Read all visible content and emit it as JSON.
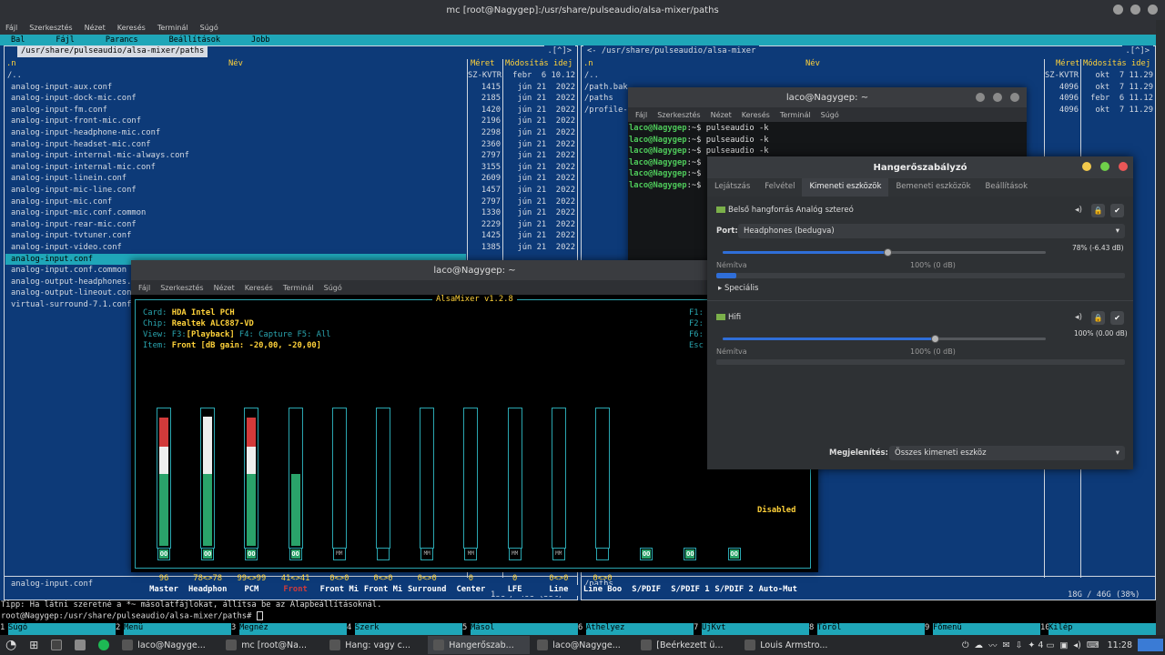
{
  "mc_title": "mc [root@Nagygep]:/usr/share/pulseaudio/alsa-mixer/paths",
  "mc_menubar": [
    "Fájl",
    "Szerkesztés",
    "Nézet",
    "Keresés",
    "Terminál",
    "Súgó"
  ],
  "mc_topbar": [
    "Bal",
    "Fájl",
    "Parancs",
    "Beállítások",
    "Jobb"
  ],
  "left_panel": {
    "path": " /usr/share/pulseaudio/alsa-mixer/paths ",
    "scroll": ".[^]>",
    "col_n": ".n",
    "col_name": "Név",
    "col_size": "Méret",
    "col_mtime": "Módosítás idej",
    "rows": [
      {
        "name": "/..",
        "size": "SZ-KVTR",
        "mtime": "febr  6 10.12"
      },
      {
        "name": "analog-input-aux.conf",
        "size": "1415",
        "mtime": "jún 21  2022"
      },
      {
        "name": "analog-input-dock-mic.conf",
        "size": "2185",
        "mtime": "jún 21  2022"
      },
      {
        "name": "analog-input-fm.conf",
        "size": "1420",
        "mtime": "jún 21  2022"
      },
      {
        "name": "analog-input-front-mic.conf",
        "size": "2196",
        "mtime": "jún 21  2022"
      },
      {
        "name": "analog-input-headphone-mic.conf",
        "size": "2298",
        "mtime": "jún 21  2022"
      },
      {
        "name": "analog-input-headset-mic.conf",
        "size": "2360",
        "mtime": "jún 21  2022"
      },
      {
        "name": "analog-input-internal-mic-always.conf",
        "size": "2797",
        "mtime": "jún 21  2022"
      },
      {
        "name": "analog-input-internal-mic.conf",
        "size": "3155",
        "mtime": "jún 21  2022"
      },
      {
        "name": "analog-input-linein.conf",
        "size": "2609",
        "mtime": "jún 21  2022"
      },
      {
        "name": "analog-input-mic-line.conf",
        "size": "1457",
        "mtime": "jún 21  2022"
      },
      {
        "name": "analog-input-mic.conf",
        "size": "2797",
        "mtime": "jún 21  2022"
      },
      {
        "name": "analog-input-mic.conf.common",
        "size": "1330",
        "mtime": "jún 21  2022"
      },
      {
        "name": "analog-input-rear-mic.conf",
        "size": "2229",
        "mtime": "jún 21  2022"
      },
      {
        "name": "analog-input-tvtuner.conf",
        "size": "1425",
        "mtime": "jún 21  2022"
      },
      {
        "name": "analog-input-video.conf",
        "size": "1385",
        "mtime": "jún 21  2022"
      },
      {
        "name": "analog-input.conf",
        "size": "",
        "mtime": ""
      },
      {
        "name": "analog-input.conf.common",
        "size": "",
        "mtime": ""
      },
      {
        "name": "analog-output-headphones.",
        "size": "",
        "mtime": ""
      },
      {
        "name": "analog-output-lineout.con",
        "size": "",
        "mtime": ""
      },
      {
        "name": "virtual-surround-7.1.conf",
        "size": "",
        "mtime": ""
      }
    ],
    "selected_index": 16,
    "mini": "analog-input.conf",
    "free": "18G / 46G (38%)"
  },
  "right_panel": {
    "path": "<- /usr/share/pulseaudio/alsa-mixer",
    "scroll": ".[^]>",
    "col_n": ".n",
    "col_name": "Név",
    "col_size": "Méret",
    "col_mtime": "Módosítás idej",
    "rows": [
      {
        "name": "/..",
        "size": "SZ-KVTR",
        "mtime": "okt  7 11.29"
      },
      {
        "name": "/path.bak",
        "size": "4096",
        "mtime": "okt  7 11.29"
      },
      {
        "name": "/paths",
        "size": "4096",
        "mtime": "febr  6 11.12"
      },
      {
        "name": "/profile-",
        "size": "4096",
        "mtime": "okt  7 11.29"
      }
    ],
    "mini": "/paths",
    "free": "18G / 46G (38%)"
  },
  "tip": "Tipp: Ha látni szeretné a *~ másolatfájlokat, állítsa be az Alapbeállításoknál.",
  "prompt": "root@Nagygep:/usr/share/pulseaudio/alsa-mixer/paths# ",
  "fkeys": [
    {
      "n": "1",
      "l": "Súgó"
    },
    {
      "n": "2",
      "l": "Menü"
    },
    {
      "n": "3",
      "l": "Megnéz"
    },
    {
      "n": "4",
      "l": "Szerk"
    },
    {
      "n": "5",
      "l": "Másol"
    },
    {
      "n": "6",
      "l": "Áthelyez"
    },
    {
      "n": "7",
      "l": "ÚjKvt"
    },
    {
      "n": "8",
      "l": "Töröl"
    },
    {
      "n": "9",
      "l": "Főmenü"
    },
    {
      "n": "10",
      "l": "Kilép"
    }
  ],
  "pulse_term": {
    "title": "laco@Nagygep: ~",
    "menu": [
      "Fájl",
      "Szerkesztés",
      "Nézet",
      "Keresés",
      "Terminál",
      "Súgó"
    ],
    "lines": [
      {
        "user": "laco@Nagygep",
        "rest": ":~$ pulseaudio -k"
      },
      {
        "user": "laco@Nagygep",
        "rest": ":~$ pulseaudio -k"
      },
      {
        "user": "laco@Nagygep",
        "rest": ":~$ pulseaudio -k"
      },
      {
        "user": "laco@Nagygep",
        "rest": ":~$"
      },
      {
        "user": "laco@Nagygep",
        "rest": ":~$"
      },
      {
        "user": "laco@Nagygep",
        "rest": ":~$"
      }
    ]
  },
  "alsa_term": {
    "title": "laco@Nagygep: ~",
    "menu": [
      "Fájl",
      "Szerkesztés",
      "Nézet",
      "Keresés",
      "Terminál",
      "Súgó"
    ],
    "mixer_title": "AlsaMixer v1.2.8",
    "card_label": "Card:",
    "card": "HDA Intel PCH",
    "chip_label": "Chip:",
    "chip": "Realtek ALC887-VD",
    "view_label": "View:",
    "view_f3": "F3:",
    "view_playback": "[Playback]",
    "view_f4": " F4: Capture  F5: All",
    "item_label": "Item:",
    "item": "Front [dB gain: -20,00, -20,00]",
    "fkeys_right": [
      "F1:",
      "F2:",
      "F6:",
      "Esc"
    ],
    "disabled": "Disabled",
    "channels": [
      {
        "name": "Master",
        "level": "96",
        "mute": "OO",
        "green": 0.53,
        "white": 0.2,
        "red": 0.21
      },
      {
        "name": "Headphon",
        "level": "78<>78",
        "mute": "OO",
        "green": 0.53,
        "white": 0.42,
        "red": 0
      },
      {
        "name": "PCM",
        "level": "99<>99",
        "mute": "OO",
        "green": 0.53,
        "white": 0.2,
        "red": 0.21
      },
      {
        "name": "Front",
        "level": "41<>41",
        "mute": "OO",
        "green": 0.53,
        "white": 0,
        "red": 0,
        "selected": true
      },
      {
        "name": "Front Mi",
        "level": "0<>0",
        "mute": "MM",
        "green": 0,
        "white": 0,
        "red": 0
      },
      {
        "name": "Front Mi",
        "level": "0<>0",
        "mute": "",
        "green": 0,
        "white": 0,
        "red": 0
      },
      {
        "name": "Surround",
        "level": "0<>0",
        "mute": "MM",
        "green": 0,
        "white": 0,
        "red": 0
      },
      {
        "name": "Center",
        "level": "0",
        "mute": "MM",
        "green": 0,
        "white": 0,
        "red": 0
      },
      {
        "name": "LFE",
        "level": "0",
        "mute": "MM",
        "green": 0,
        "white": 0,
        "red": 0
      },
      {
        "name": "Line",
        "level": "0<>0",
        "mute": "MM",
        "green": 0,
        "white": 0,
        "red": 0
      },
      {
        "name": "Line Boo",
        "level": "0<>0",
        "mute": "",
        "green": 0,
        "white": 0,
        "red": 0
      },
      {
        "name": "S/PDIF",
        "level": "",
        "mute": "OO",
        "switch": true
      },
      {
        "name": "S/PDIF 1",
        "level": "",
        "mute": "OO",
        "switch": true
      },
      {
        "name": "S/PDIF 2",
        "level": "",
        "mute": "OO",
        "switch": true
      },
      {
        "name": "Auto-Mut",
        "level": "",
        "mute": "",
        "switch": true
      }
    ]
  },
  "volume": {
    "title": "Hangerőszabályzó",
    "tabs": [
      "Lejátszás",
      "Felvétel",
      "Kimeneti eszközök",
      "Bemeneti eszközök",
      "Beállítások"
    ],
    "active_tab": 2,
    "dev1": "Belső hangforrás Analóg sztereó",
    "port_label": "Port:",
    "port_value": "Headphones (bedugva)",
    "dev1_pct": "78% (-6.43 dB)",
    "dev1_level": 0.78,
    "muted_label": "Némítva",
    "full_label": "100% (0 dB)",
    "special": "Speciális",
    "dev2": "Hifi",
    "dev2_pct": "100% (0.00 dB)",
    "dev2_level": 1.0,
    "show_label": "Megjelenítés:",
    "show_value": "Összes kimeneti eszköz"
  },
  "taskbar": {
    "items": [
      "laco@Nagyge...",
      "mc [root@Na...",
      "Hang: vagy c...",
      "Hangerőszab...",
      "laco@Nagyge...",
      "[Beérkezett ü...",
      "Louis Armstro..."
    ],
    "active_index": 3,
    "tray_count": "4",
    "clock": "11:28"
  }
}
